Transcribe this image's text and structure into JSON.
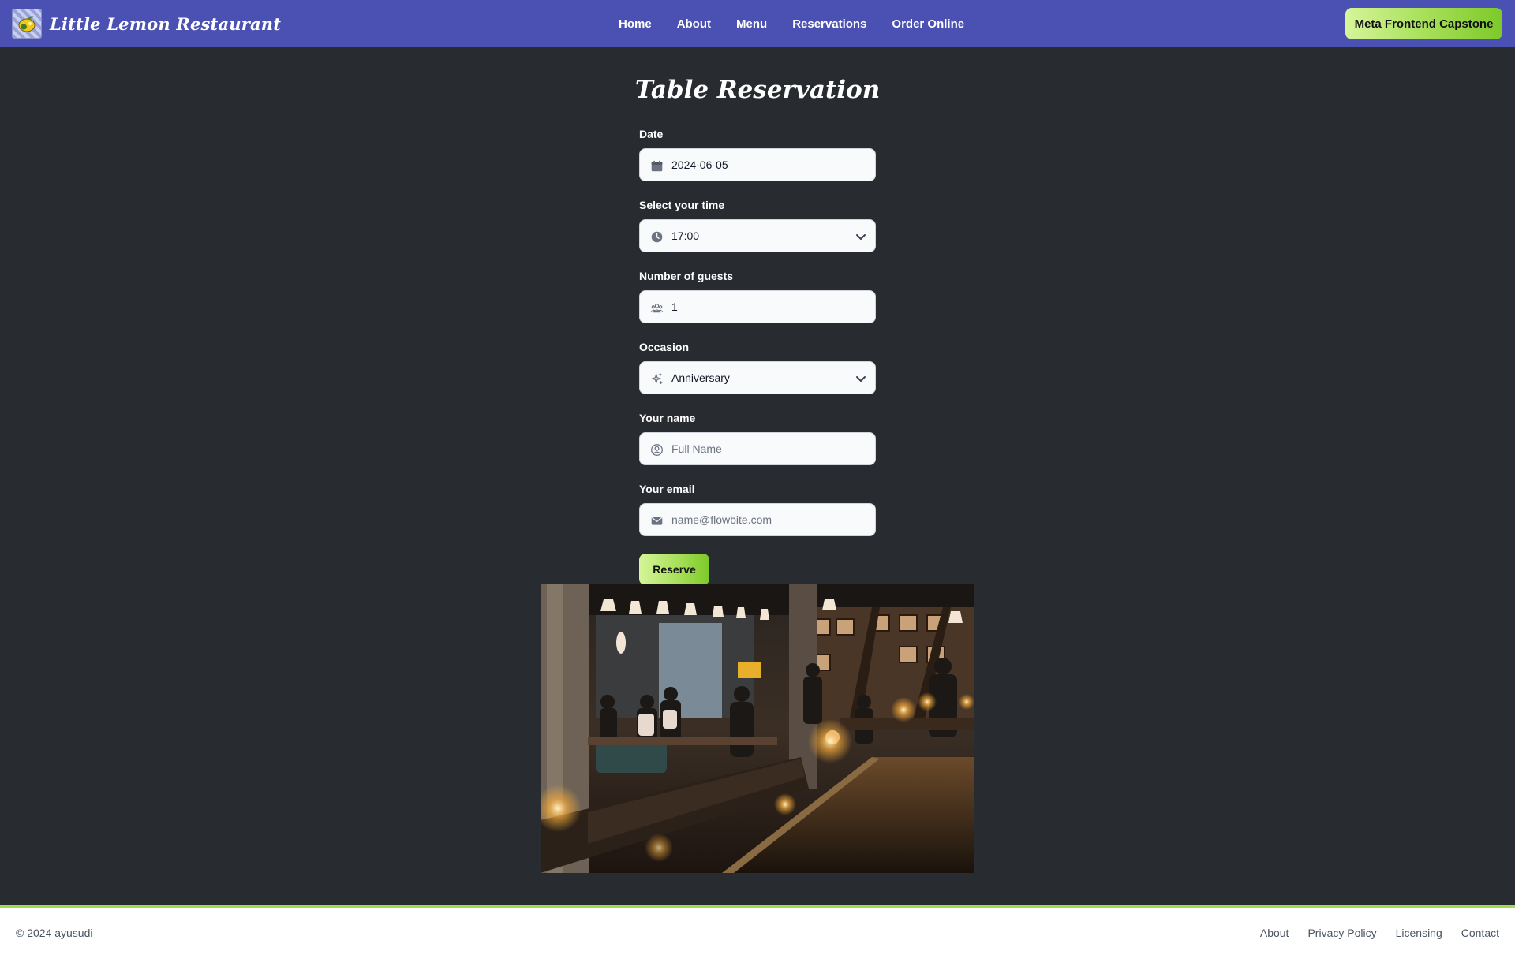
{
  "header": {
    "brand": "Little Lemon Restaurant",
    "logo_icon": "lemon-logo-icon",
    "nav": [
      {
        "label": "Home"
      },
      {
        "label": "About"
      },
      {
        "label": "Menu"
      },
      {
        "label": "Reservations"
      },
      {
        "label": "Order Online"
      }
    ],
    "cta_label": "Meta Frontend Capstone"
  },
  "form": {
    "title": "Table Reservation",
    "date": {
      "label": "Date",
      "value": "2024-06-05",
      "icon": "calendar-icon"
    },
    "time": {
      "label": "Select your time",
      "value": "17:00",
      "icon": "clock-icon"
    },
    "guests": {
      "label": "Number of guests",
      "value": "1",
      "icon": "users-icon"
    },
    "occasion": {
      "label": "Occasion",
      "value": "Anniversary",
      "icon": "sparkle-icon"
    },
    "name": {
      "label": "Your name",
      "placeholder": "Full Name",
      "icon": "user-circle-icon"
    },
    "email": {
      "label": "Your email",
      "placeholder": "name@flowbite.com",
      "icon": "envelope-icon"
    },
    "submit_label": "Reserve"
  },
  "footer": {
    "copyright": "© 2024 ayusudi",
    "links": [
      {
        "label": "About"
      },
      {
        "label": "Privacy Policy"
      },
      {
        "label": "Licensing"
      },
      {
        "label": "Contact"
      }
    ]
  },
  "colors": {
    "header_bg": "#4b51b3",
    "page_bg": "#282b30",
    "accent_green": "#9be04a",
    "footer_bg": "#ffffff"
  }
}
